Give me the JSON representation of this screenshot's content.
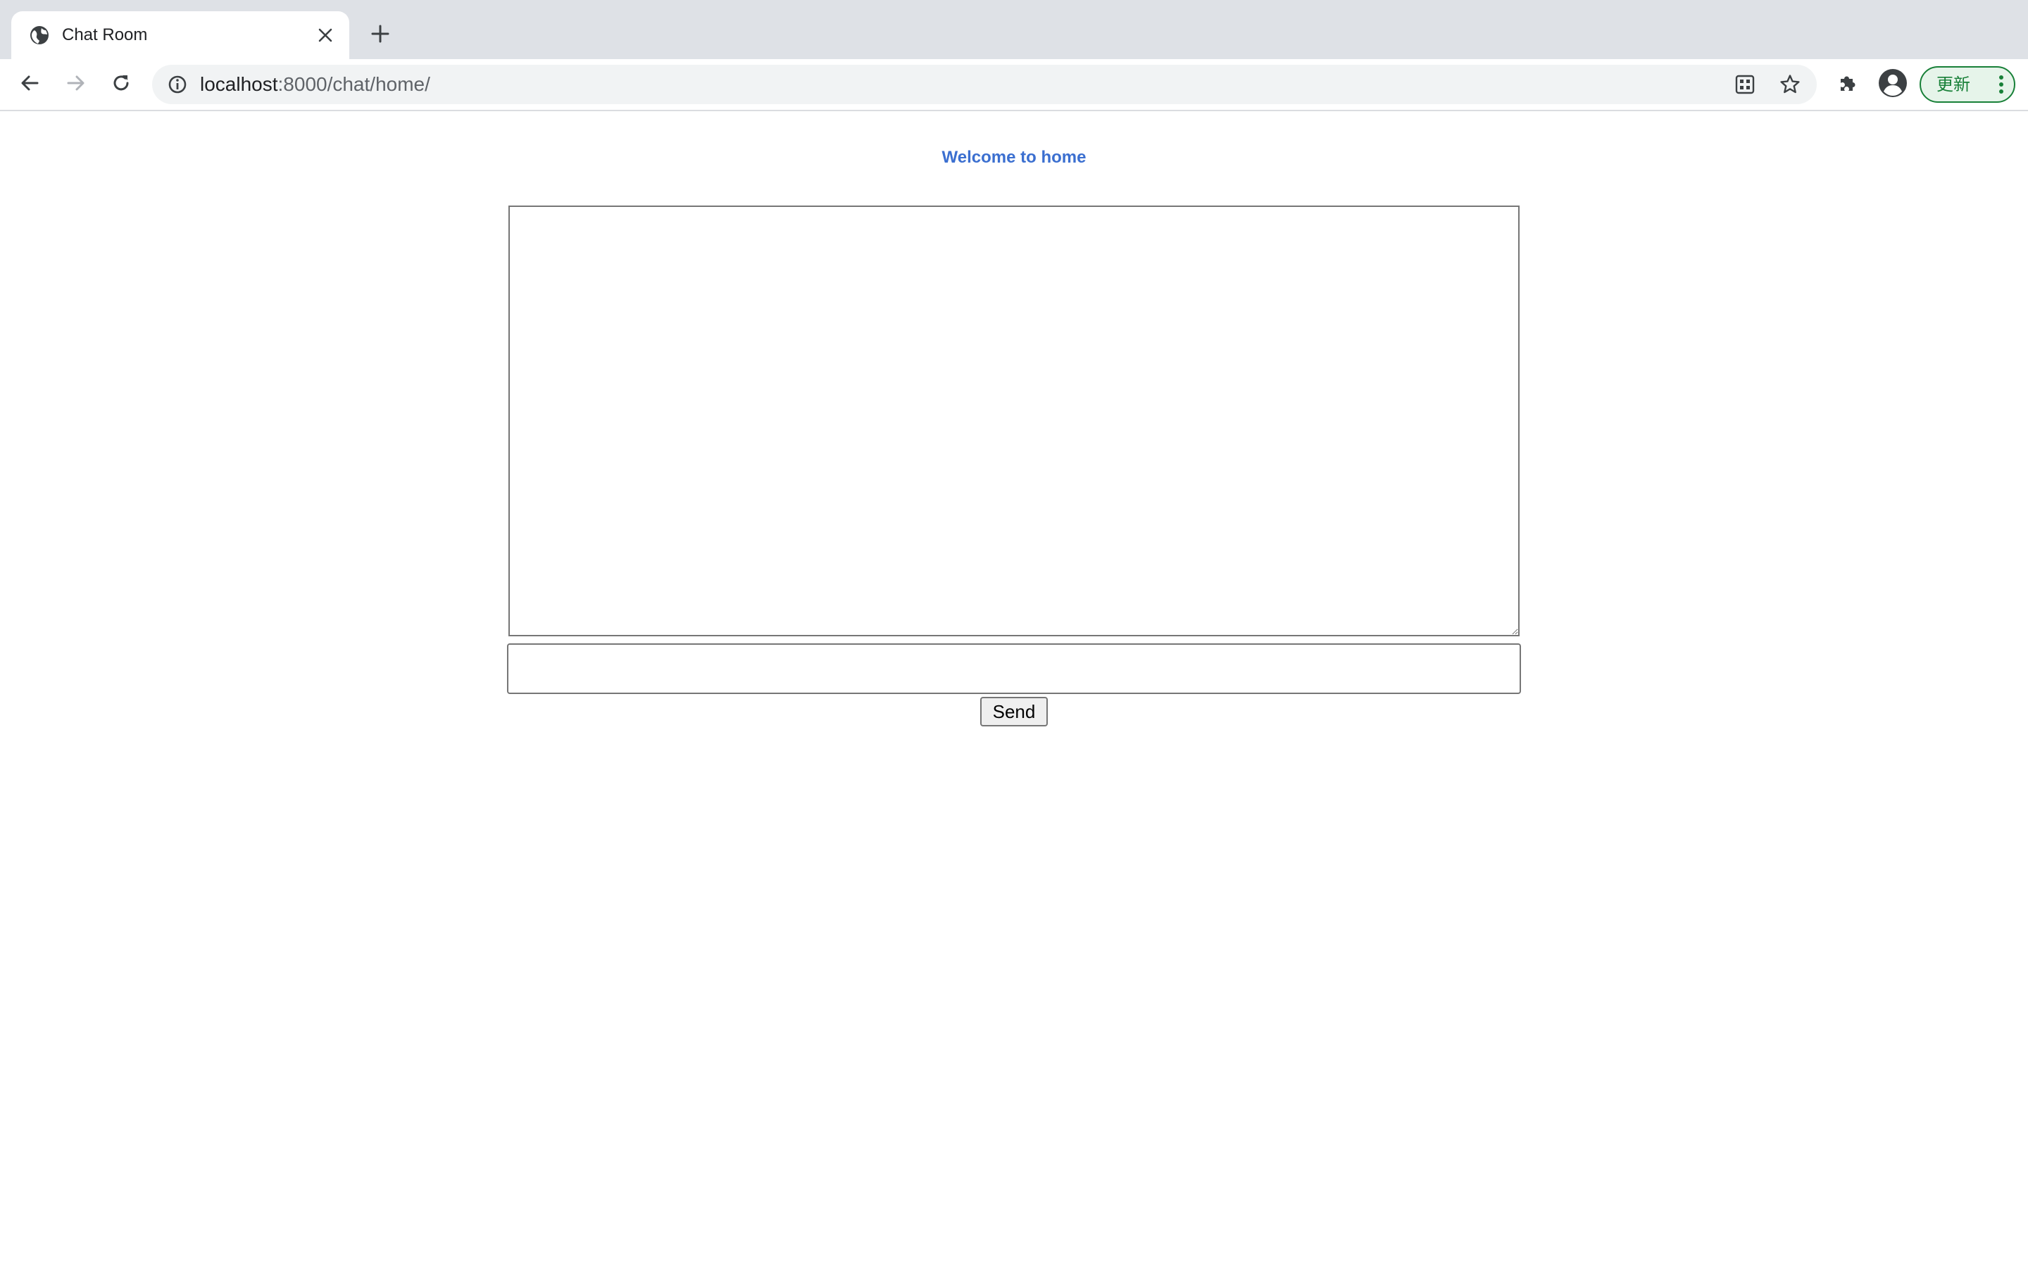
{
  "browser": {
    "tab": {
      "title": "Chat Room",
      "favicon": "globe-icon",
      "close_icon": "close-icon"
    },
    "new_tab_icon": "plus-icon",
    "toolbar": {
      "back_icon": "back-arrow-icon",
      "forward_icon": "forward-arrow-icon",
      "reload_icon": "reload-icon",
      "site_info_icon": "info-icon",
      "url_host": "localhost",
      "url_rest": ":8000/chat/home/",
      "qr_icon": "qr-code-icon",
      "bookmark_icon": "star-icon",
      "extensions_icon": "puzzle-icon",
      "profile_icon": "account-icon",
      "update_label": "更新",
      "menu_icon": "kebab-menu-icon"
    },
    "colors": {
      "tabstrip_bg": "#dee1e6",
      "omnibox_bg": "#f1f3f4",
      "update_green": "#188038",
      "welcome_blue": "#3b6fd0"
    }
  },
  "page": {
    "heading": "Welcome to home",
    "chat_log_value": "",
    "message_input_value": "",
    "send_label": "Send"
  }
}
